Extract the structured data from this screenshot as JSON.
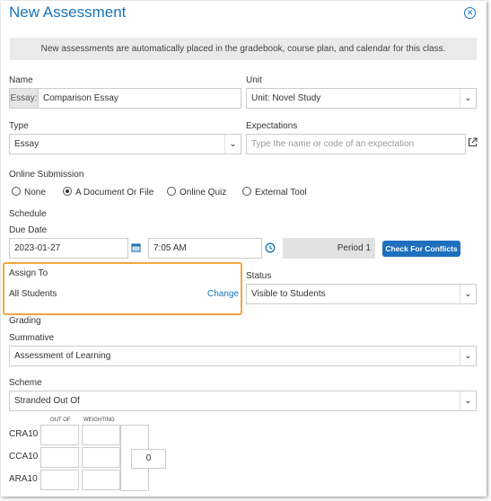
{
  "dialog": {
    "title": "New Assessment",
    "close_icon": "close-circle-icon",
    "notice": "New assessments are automatically placed in the gradebook, course plan, and calendar for this class."
  },
  "name": {
    "label": "Name",
    "prefix": "Essay:",
    "value": "Comparison Essay"
  },
  "unit": {
    "label": "Unit",
    "value": "Unit: Novel Study"
  },
  "type": {
    "label": "Type",
    "value": "Essay"
  },
  "expectations": {
    "label": "Expectations",
    "placeholder": "Type the name or code of an expectation",
    "link_icon": "external-link-icon"
  },
  "online_submission": {
    "label": "Online Submission",
    "options": [
      {
        "label": "None",
        "selected": false
      },
      {
        "label": "A Document Or File",
        "selected": true
      },
      {
        "label": "Online Quiz",
        "selected": false
      },
      {
        "label": "External Tool",
        "selected": false
      }
    ]
  },
  "schedule": {
    "label": "Schedule",
    "due_date_label": "Due Date",
    "date": "2023-01-27",
    "time": "7:05 AM",
    "period": "Period 1",
    "check_button": "Check For Conflicts"
  },
  "assign_to": {
    "label": "Assign To",
    "value": "All Students",
    "change_link": "Change",
    "highlight_color": "#f2a640"
  },
  "status": {
    "label": "Status",
    "value": "Visible to Students"
  },
  "grading": {
    "label": "Grading",
    "summative_label": "Summative",
    "summative_value": "Assessment of Learning",
    "scheme_label": "Scheme",
    "scheme_value": "Stranded Out Of",
    "col_out_of": "OUT OF",
    "col_weighting": "WEIGHTING",
    "rows": [
      "CRA10",
      "CCA10",
      "ARA10"
    ],
    "total": "0"
  },
  "colors": {
    "accent": "#1a73b8",
    "button": "#1f6fbf"
  }
}
